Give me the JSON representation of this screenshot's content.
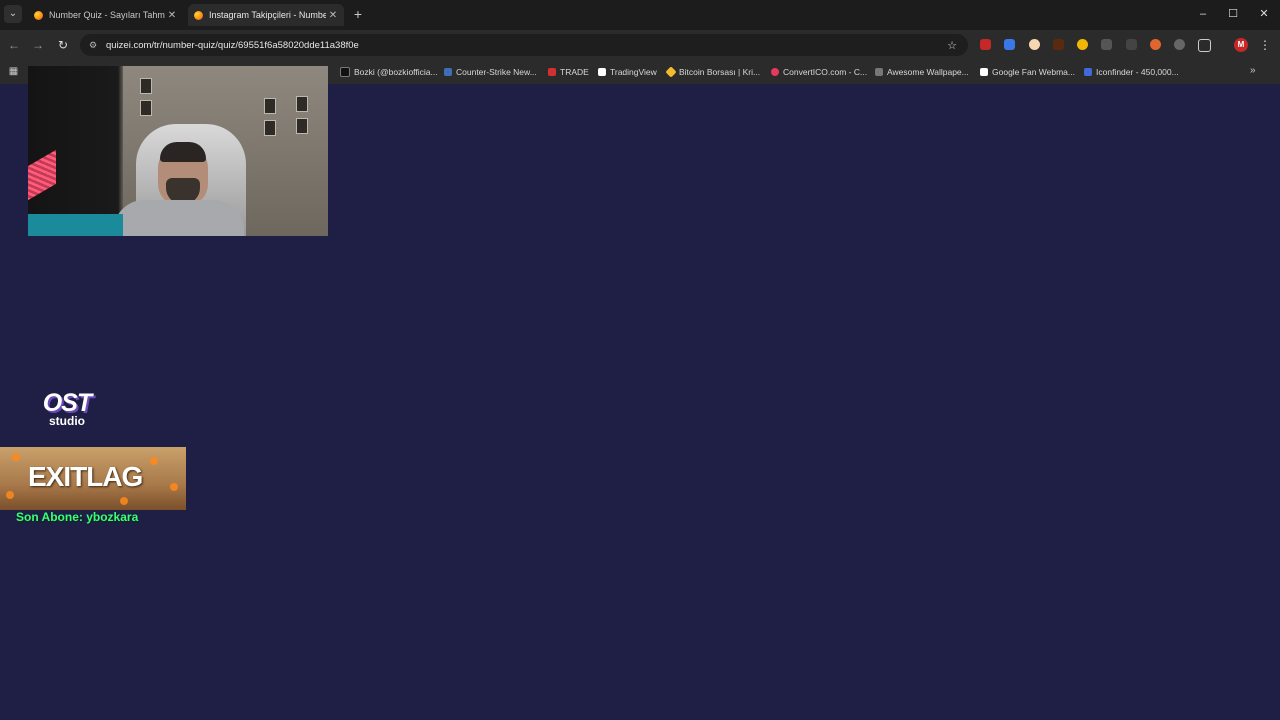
{
  "browser": {
    "tabs": [
      {
        "title": "Number Quiz - Sayıları Tahmin",
        "active": false
      },
      {
        "title": "Instagram Takipçileri - Number",
        "active": true
      }
    ],
    "new_tab_label": "+",
    "window_controls": {
      "minimize": "–",
      "maximize": "☐",
      "close": "✕"
    },
    "url": "quizei.com/tr/number-quiz/quiz/69551f6a58020dde11a38f0e",
    "bookmarks": [
      {
        "label": "Bozki (@bozkiofficia...",
        "color": "#111111"
      },
      {
        "label": "Counter-Strike New...",
        "color": "#3d6fb6"
      },
      {
        "label": "TRADE",
        "color": "#d32f2f"
      },
      {
        "label": "TradingView",
        "color": "#ffffff"
      },
      {
        "label": "Bitcoin Borsası | Kri...",
        "color": "#f3ba2f"
      },
      {
        "label": "ConvertICO.com - C...",
        "color": "#e6395f"
      },
      {
        "label": "Awesome Wallpape...",
        "color": "#777777"
      },
      {
        "label": "Google Fan Webma...",
        "color": "#ffffff"
      },
      {
        "label": "Iconfinder - 450,000...",
        "color": "#3f6ad8"
      }
    ],
    "profile_initial": "M"
  },
  "overlay": {
    "ost_logo": {
      "top": "OST",
      "bottom": "studio"
    },
    "sponsor": "EXITLAG",
    "last_subscriber": "Son Abone: ybozkara"
  },
  "colors": {
    "page_background": "#1f1f45",
    "subscriber_text": "#39ff7a"
  }
}
